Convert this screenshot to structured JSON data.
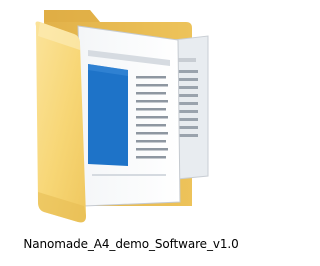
{
  "desktop": {
    "folder": {
      "name": "Nanomade_A4_demo_Software_v1.0",
      "icon": "folder-with-documents-icon",
      "colors": {
        "folder_front": "#F8D775",
        "folder_back": "#E9BC4C",
        "document_accent": "#1E73C8"
      }
    }
  }
}
